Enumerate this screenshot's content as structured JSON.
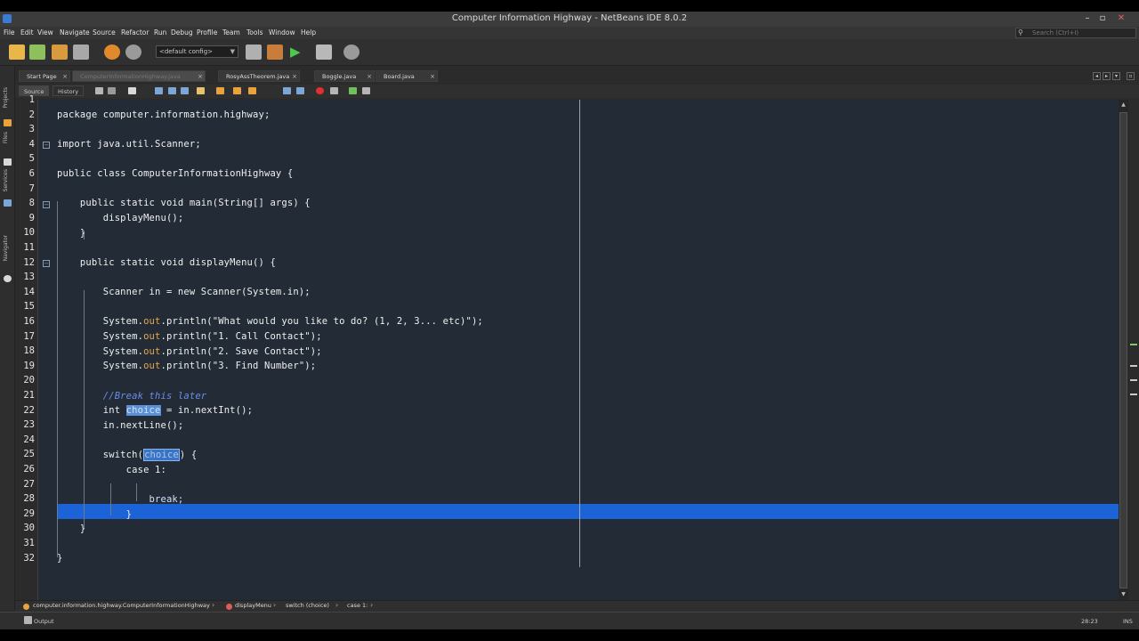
{
  "window": {
    "title": "Computer Information Highway - NetBeans IDE 8.0.2"
  },
  "menu": [
    "File",
    "Edit",
    "View",
    "Navigate",
    "Source",
    "Refactor",
    "Run",
    "Debug",
    "Profile",
    "Team",
    "Tools",
    "Window",
    "Help"
  ],
  "search": {
    "placeholder": "Search (Ctrl+I)"
  },
  "toolbar": {
    "config": "<default config>"
  },
  "side_panels": [
    "Projects",
    "Files",
    "Services",
    "Navigator"
  ],
  "tabs": [
    {
      "label": "Start Page",
      "active": false
    },
    {
      "label": "ComputerInformationHighway.java",
      "active": true
    },
    {
      "label": "RosyAssTheorem.java",
      "active": false
    },
    {
      "label": "Boggle.java",
      "active": false
    },
    {
      "label": "Board.java",
      "active": false
    }
  ],
  "editor_modes": {
    "source": "Source",
    "history": "History"
  },
  "code": {
    "line_numbers": [
      "1",
      "2",
      "3",
      "4",
      "5",
      "6",
      "7",
      "8",
      "9",
      "10",
      "11",
      "12",
      "13",
      "14",
      "15",
      "16",
      "17",
      "18",
      "19",
      "20",
      "21",
      "22",
      "23",
      "24",
      "25",
      "26",
      "27",
      "28",
      "29",
      "30",
      "31",
      "32"
    ],
    "l2": "package computer.information.highway;",
    "l4": "import java.util.Scanner;",
    "l6": "public class ComputerInformationHighway {",
    "l8a": "    public static void main(String[] args) {",
    "l9": "        displayMenu();",
    "l10": "    }",
    "l12": "    public static void displayMenu() {",
    "l14": "        Scanner in = new Scanner(System.in);",
    "l16_sys": "        System.",
    "l16_out": "out",
    "l16_rest": ".println(\"What would you like to do? (1, 2, 3... etc)\");",
    "l17_rest": ".println(\"1. Call Contact\");",
    "l18_rest": ".println(\"2. Save Contact\");",
    "l19_rest": ".println(\"3. Find Number\");",
    "l21": "        //Break this later",
    "l22_pre": "        int ",
    "l22_var": "choice",
    "l22_post": " = in.nextInt();",
    "l23": "        in.nextLine();",
    "l25_pre": "        switch(",
    "l25_var": "choice",
    "l25_post": ") {",
    "l26": "            case 1:",
    "l28": "                break;",
    "l29": "            }",
    "l30": "    }",
    "l32": "}"
  },
  "breadcrumb": [
    "computer.information.highway.ComputerInformationHighway",
    "displayMenu",
    "switch (choice)",
    "case 1:"
  ],
  "status": {
    "output": "Output",
    "position": "28:23",
    "mode": "INS"
  }
}
